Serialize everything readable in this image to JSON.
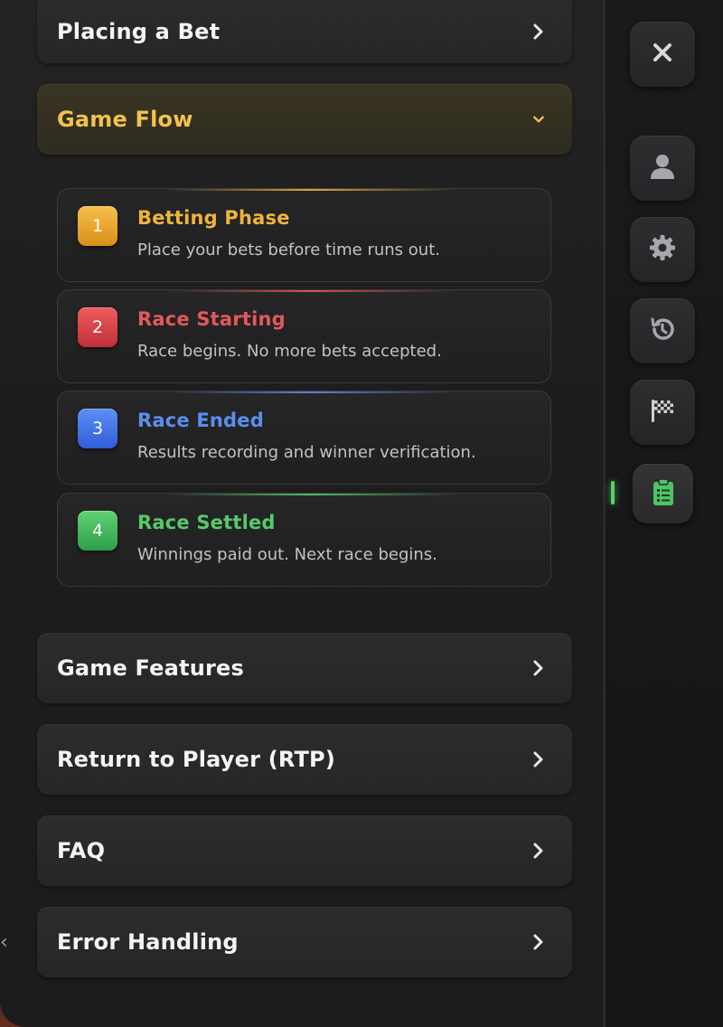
{
  "accordion": {
    "placing_bet": "Placing a Bet",
    "game_flow": "Game Flow",
    "game_features": "Game Features",
    "rtp": "Return to Player (RTP)",
    "faq": "FAQ",
    "error_handling": "Error Handling"
  },
  "steps": [
    {
      "num": "1",
      "title": "Betting Phase",
      "desc": "Place your bets before time runs out.",
      "color": "#f0b43c"
    },
    {
      "num": "2",
      "title": "Race Starting",
      "desc": "Race begins. No more bets accepted.",
      "color": "#e2595d"
    },
    {
      "num": "3",
      "title": "Race Ended",
      "desc": "Results recording and winner verification.",
      "color": "#5b8ef0"
    },
    {
      "num": "4",
      "title": "Race Settled",
      "desc": "Winnings paid out. Next race begins.",
      "color": "#57c96b"
    }
  ],
  "sidebar": {
    "icons": [
      "close-icon",
      "user-icon",
      "gear-icon",
      "history-icon",
      "checkered-flag-icon",
      "clipboard-list-icon"
    ],
    "active": "clipboard-list-icon",
    "active_color": "#58d36b"
  },
  "colors": {
    "accent_gold": "#f1c24e",
    "text_primary": "#f4f4f5"
  }
}
